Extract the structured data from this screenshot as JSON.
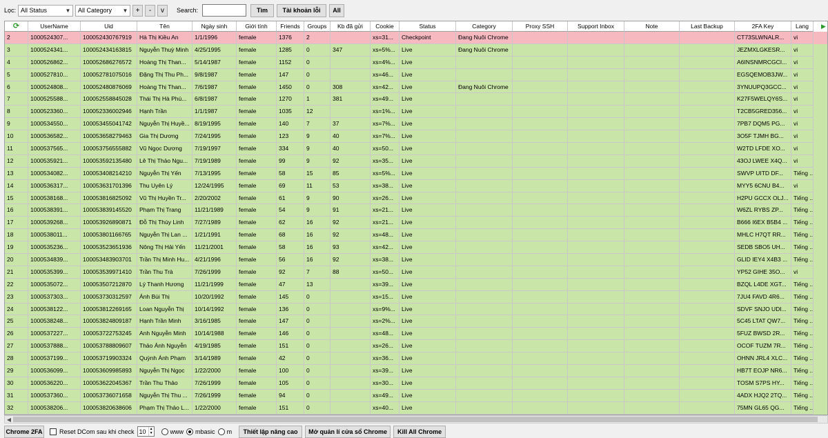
{
  "toolbar": {
    "filter_label": "Lọc:",
    "status_value": "All Status",
    "category_value": "All Category",
    "plus": "+",
    "minus": "-",
    "chevron": "v",
    "search_label": "Search:",
    "search_value": "",
    "find_label": "Tìm",
    "error_accounts_label": "Tài khoản lỗi",
    "all_label": "All"
  },
  "columns": [
    "",
    "UserName",
    "Uid",
    "Tên",
    "Ngày sinh",
    "Giới tính",
    "Friends",
    "Groups",
    "Kb đã gửi",
    "Cookie",
    "Status",
    "Category",
    "Proxy SSH",
    "Support Inbox",
    "Note",
    "Last Backup",
    "2FA Key",
    "Lang"
  ],
  "rows": [
    [
      "2",
      "1000524307...",
      "100052430767919",
      "Hà Thị Kiều An",
      "1/1/1996",
      "female",
      "1376",
      "2",
      "",
      "xs=31...",
      "Checkpoint",
      "Đang Nuôi Chrome",
      "",
      "",
      "",
      "",
      "CT73SLWNALR...",
      "vi"
    ],
    [
      "3",
      "1000524341...",
      "100052434163815",
      "Nguyễn Thuỳ Minh",
      "4/25/1995",
      "female",
      "1285",
      "0",
      "347",
      "xs=5%...",
      "Live",
      "Đang Nuôi Chrome",
      "",
      "",
      "",
      "",
      "JEZMXLGKESR...",
      "vi"
    ],
    [
      "4",
      "1000526862...",
      "100052686276572",
      "Hoàng Thị Than...",
      "5/14/1987",
      "female",
      "1152",
      "0",
      "",
      "xs=4%...",
      "Live",
      "",
      "",
      "",
      "",
      "",
      "A6INSNMRCGCI...",
      "vi"
    ],
    [
      "5",
      "1000527810...",
      "100052781075016",
      "Đặng Thị Thu Ph...",
      "9/8/1987",
      "female",
      "147",
      "0",
      "",
      "xs=46...",
      "Live",
      "",
      "",
      "",
      "",
      "",
      "EGSQEMOB3JW...",
      "vi"
    ],
    [
      "6",
      "1000524808...",
      "100052480876069",
      "Hoàng Thị Than...",
      "7/6/1987",
      "female",
      "1450",
      "0",
      "308",
      "xs=42...",
      "Live",
      "Đang Nuôi Chrome",
      "",
      "",
      "",
      "",
      "3YNUUPQ3GCC...",
      "vi"
    ],
    [
      "7",
      "1000525588...",
      "100052558845028",
      "Thái Thị Hà Phú...",
      "6/8/1987",
      "female",
      "1270",
      "1",
      "381",
      "xs=49...",
      "Live",
      "",
      "",
      "",
      "",
      "",
      "K27F5WELQY6S...",
      "vi"
    ],
    [
      "8",
      "1000523360...",
      "100052336002946",
      "Hạnh Trần",
      "1/1/1987",
      "female",
      "1035",
      "12",
      "",
      "xs=1%...",
      "Live",
      "",
      "",
      "",
      "",
      "",
      "T2CB5GRED356...",
      "vi"
    ],
    [
      "9",
      "1000534550...",
      "100053455041742",
      "Nguyễn Thị Huyề...",
      "8/19/1995",
      "female",
      "140",
      "7",
      "37",
      "xs=7%...",
      "Live",
      "",
      "",
      "",
      "",
      "",
      "7PB7 DQM5 PG...",
      "vi"
    ],
    [
      "10",
      "1000536582...",
      "100053658279463",
      "Gia Thị Dương",
      "7/24/1995",
      "female",
      "123",
      "9",
      "40",
      "xs=7%...",
      "Live",
      "",
      "",
      "",
      "",
      "",
      "3O5F TJMH BG...",
      "vi"
    ],
    [
      "11",
      "1000537565...",
      "100053756555882",
      "Vũ Ngọc Dương",
      "7/19/1997",
      "female",
      "334",
      "9",
      "40",
      "xs=50...",
      "Live",
      "",
      "",
      "",
      "",
      "",
      "W2TD LFDE XO...",
      "vi"
    ],
    [
      "12",
      "1000535921...",
      "100053592135480",
      "Lê Thị Thảo Ngu...",
      "7/19/1989",
      "female",
      "99",
      "9",
      "92",
      "xs=35...",
      "Live",
      "",
      "",
      "",
      "",
      "",
      "43OJ LWEE X4Q...",
      "vi"
    ],
    [
      "13",
      "1000534082...",
      "100053408214210",
      "Nguyễn Thị Yến",
      "7/13/1995",
      "female",
      "58",
      "15",
      "85",
      "xs=5%...",
      "Live",
      "",
      "",
      "",
      "",
      "",
      "SWVP UITD DF...",
      "Tiếng ..."
    ],
    [
      "14",
      "1000536317...",
      "100053631701396",
      "Thu Uyên Lý",
      "12/24/1995",
      "female",
      "69",
      "11",
      "53",
      "xs=38...",
      "Live",
      "",
      "",
      "",
      "",
      "",
      "MYY5 6CNU B4...",
      "vi"
    ],
    [
      "15",
      "1000538168...",
      "100053816825092",
      "Vũ Thị Huyền Tr...",
      "2/20/2002",
      "female",
      "61",
      "9",
      "90",
      "xs=26...",
      "Live",
      "",
      "",
      "",
      "",
      "",
      "H2PU GCCX OLJ...",
      "Tiếng ..."
    ],
    [
      "16",
      "1000538391...",
      "100053839145520",
      "Phạm Thị Trang",
      "11/21/1989",
      "female",
      "54",
      "9",
      "91",
      "xs=21...",
      "Live",
      "",
      "",
      "",
      "",
      "",
      "W6ZL RYBS ZP...",
      "Tiếng ..."
    ],
    [
      "17",
      "1000539268...",
      "100053926890871",
      "Đỗ Thị Thùy Linh",
      "7/27/1989",
      "female",
      "62",
      "16",
      "92",
      "xs=21...",
      "Live",
      "",
      "",
      "",
      "",
      "",
      "B666 I6EX B5B4 ...",
      "Tiếng ..."
    ],
    [
      "18",
      "1000538011...",
      "100053801166765",
      "Nguyễn Thị Lan ...",
      "1/21/1991",
      "female",
      "68",
      "16",
      "92",
      "xs=48...",
      "Live",
      "",
      "",
      "",
      "",
      "",
      "MHLC H7QT RR...",
      "Tiếng ..."
    ],
    [
      "19",
      "1000535236...",
      "100053523651936",
      "Nông Thị Hải Yến",
      "11/21/2001",
      "female",
      "58",
      "16",
      "93",
      "xs=42...",
      "Live",
      "",
      "",
      "",
      "",
      "",
      "SEDB SBO5 UH...",
      "Tiếng ..."
    ],
    [
      "20",
      "1000534839...",
      "100053483903701",
      "Trần Thị Minh Hu...",
      "4/21/1996",
      "female",
      "56",
      "16",
      "92",
      "xs=38...",
      "Live",
      "",
      "",
      "",
      "",
      "",
      "GLID IEY4 X4B3 ...",
      "Tiếng ..."
    ],
    [
      "21",
      "1000535399...",
      "100053539971410",
      "Trần Thu Trà",
      "7/26/1999",
      "female",
      "92",
      "7",
      "88",
      "xs=50...",
      "Live",
      "",
      "",
      "",
      "",
      "",
      "YP52 GIHE 35O...",
      "vi"
    ],
    [
      "22",
      "1000535072...",
      "100053507212870",
      "Lý Thanh Hương",
      "11/21/1999",
      "female",
      "47",
      "13",
      "",
      "xs=39...",
      "Live",
      "",
      "",
      "",
      "",
      "",
      "BZQL L4DE XGT...",
      "Tiếng ..."
    ],
    [
      "23",
      "1000537303...",
      "100053730312597",
      "Ánh Bùi Thị",
      "10/20/1992",
      "female",
      "145",
      "0",
      "",
      "xs=15...",
      "Live",
      "",
      "",
      "",
      "",
      "",
      "7JU4 FAVD 4R6...",
      "Tiếng ..."
    ],
    [
      "24",
      "1000538122...",
      "100053812269165",
      "Loan Nguyễn Thị",
      "10/14/1992",
      "female",
      "136",
      "0",
      "",
      "xs=9%...",
      "Live",
      "",
      "",
      "",
      "",
      "",
      "SDVF SNJO UDI...",
      "Tiếng ..."
    ],
    [
      "25",
      "1000538248...",
      "100053824809187",
      "Hạnh Trần Minh",
      "3/16/1985",
      "female",
      "147",
      "0",
      "",
      "xs=2%...",
      "Live",
      "",
      "",
      "",
      "",
      "",
      "5C45 LTAT QW7...",
      "Tiếng ..."
    ],
    [
      "26",
      "1000537227...",
      "100053722753245",
      "Anh Nguyễn Minh",
      "10/14/1988",
      "female",
      "146",
      "0",
      "",
      "xs=48...",
      "Live",
      "",
      "",
      "",
      "",
      "",
      "5FUZ BWSD 2R...",
      "Tiếng ..."
    ],
    [
      "27",
      "1000537888...",
      "100053788809607",
      "Thảo Ánh Nguyễn",
      "4/19/1985",
      "female",
      "151",
      "0",
      "",
      "xs=26...",
      "Live",
      "",
      "",
      "",
      "",
      "",
      "OCOF TUZM 7R...",
      "Tiếng ..."
    ],
    [
      "28",
      "1000537199...",
      "100053719903324",
      "Quỳnh Ánh Phạm",
      "3/14/1989",
      "female",
      "42",
      "0",
      "",
      "xs=36...",
      "Live",
      "",
      "",
      "",
      "",
      "",
      "OHNN JRL4 XLC...",
      "Tiếng ..."
    ],
    [
      "29",
      "1000536099...",
      "100053609985893",
      "Nguyễn Thị Ngọc",
      "1/22/2000",
      "female",
      "100",
      "0",
      "",
      "xs=39...",
      "Live",
      "",
      "",
      "",
      "",
      "",
      "HB7T EOJP NR6...",
      "Tiếng ..."
    ],
    [
      "30",
      "1000536220...",
      "100053622045367",
      "Trần Thu Thảo",
      "7/26/1999",
      "female",
      "105",
      "0",
      "",
      "xs=30...",
      "Live",
      "",
      "",
      "",
      "",
      "",
      "TOSM S7PS HY...",
      "Tiếng ..."
    ],
    [
      "31",
      "1000537360...",
      "100053736071658",
      "Nguyễn Thị Thu ...",
      "7/26/1999",
      "female",
      "94",
      "0",
      "",
      "xs=49...",
      "Live",
      "",
      "",
      "",
      "",
      "",
      "4ADX HJQ2 2TQ...",
      "Tiếng ..."
    ],
    [
      "32",
      "1000538206...",
      "100053820638606",
      "Phạm Thị Thảo L...",
      "1/22/2000",
      "female",
      "151",
      "0",
      "",
      "xs=40...",
      "Live",
      "",
      "",
      "",
      "",
      "",
      "75MN GL65 QG...",
      "Tiếng ..."
    ]
  ],
  "colors": {
    "live_row": "#c9e5a7",
    "checkpoint_row": "#f6b9c0"
  },
  "bottom": {
    "chrome2fa": "Chrome 2FA",
    "reset_label": "Reset DCom sau khi check",
    "reset_value": "10",
    "radio_www": "www",
    "radio_mbasic": "mbasic",
    "radio_m": "m",
    "advanced_label": "Thiết lập nâng cao",
    "manage_label": "Mở quản lí cửa sổ Chrome",
    "kill_label": "Kill All Chrome"
  }
}
